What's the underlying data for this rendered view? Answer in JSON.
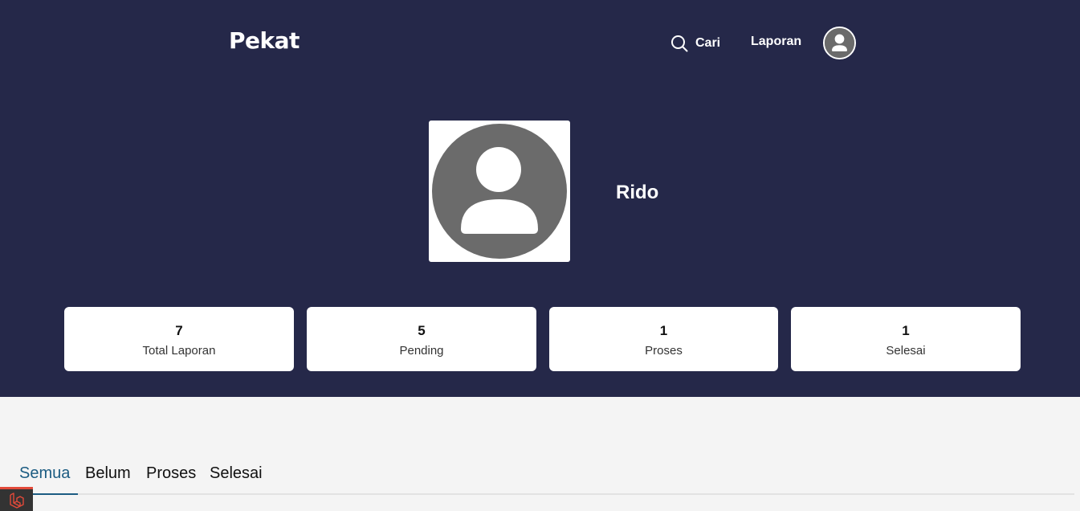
{
  "header": {
    "brand": "Pekat",
    "nav": {
      "search_label": "Cari",
      "report_label": "Laporan"
    }
  },
  "profile": {
    "name": "Rido"
  },
  "stats": [
    {
      "value": "7",
      "label": "Total Laporan"
    },
    {
      "value": "5",
      "label": "Pending"
    },
    {
      "value": "1",
      "label": "Proses"
    },
    {
      "value": "1",
      "label": "Selesai"
    }
  ],
  "tabs": [
    {
      "label": "Semua",
      "active": true
    },
    {
      "label": "Belum",
      "active": false
    },
    {
      "label": "Proses",
      "active": false
    },
    {
      "label": "Selesai",
      "active": false
    }
  ],
  "colors": {
    "hero_bg": "#252849",
    "page_bg": "#f4f4f4",
    "accent": "#1c5c82",
    "avatar_gray": "#6b6b6b",
    "debug_red": "#e24a3a"
  },
  "icons": {
    "search": "search-icon",
    "avatar": "user-avatar-icon",
    "debugbar": "laravel-logo-icon"
  }
}
